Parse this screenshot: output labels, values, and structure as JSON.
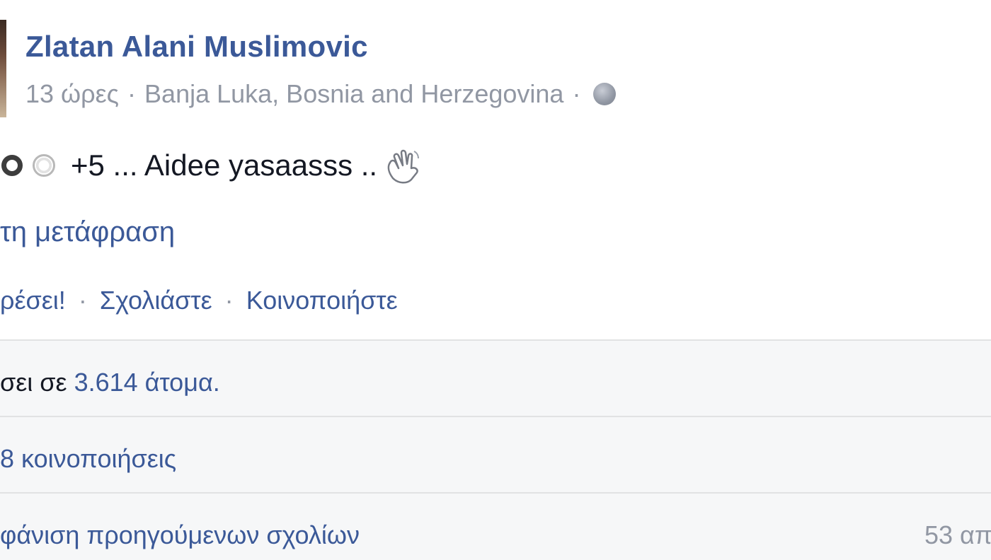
{
  "post": {
    "author": "Zlatan Alani Muslimovic",
    "time": "13 ώρες",
    "separator": "·",
    "location": "Banja Luka, Bosnia and Herzegovina",
    "text": "+5 ... Aidee yasaasss ..",
    "translate_link": "τη μετάφραση",
    "actions": {
      "like": "ρέσει!",
      "comment": "Σχολιάστε",
      "share": "Κοινοποιήστε"
    },
    "icons": {
      "privacy": "globe-icon",
      "emoji1": "ring-icon",
      "emoji2": "ring-icon",
      "emoji3": "waving-hand-icon"
    }
  },
  "ufi": {
    "reach_prefix": "σει σε",
    "reach_count": "3.614 άτομα.",
    "shares": "8 κοινοποιήσεις",
    "view_previous": "φάνιση προηγούμενων σχολίων",
    "comment_count": "53 απ"
  },
  "colors": {
    "link": "#3b5998",
    "meta": "#9197a3",
    "text": "#141823",
    "ufi_background": "#f6f7f8",
    "divider": "#e1e2e3"
  }
}
